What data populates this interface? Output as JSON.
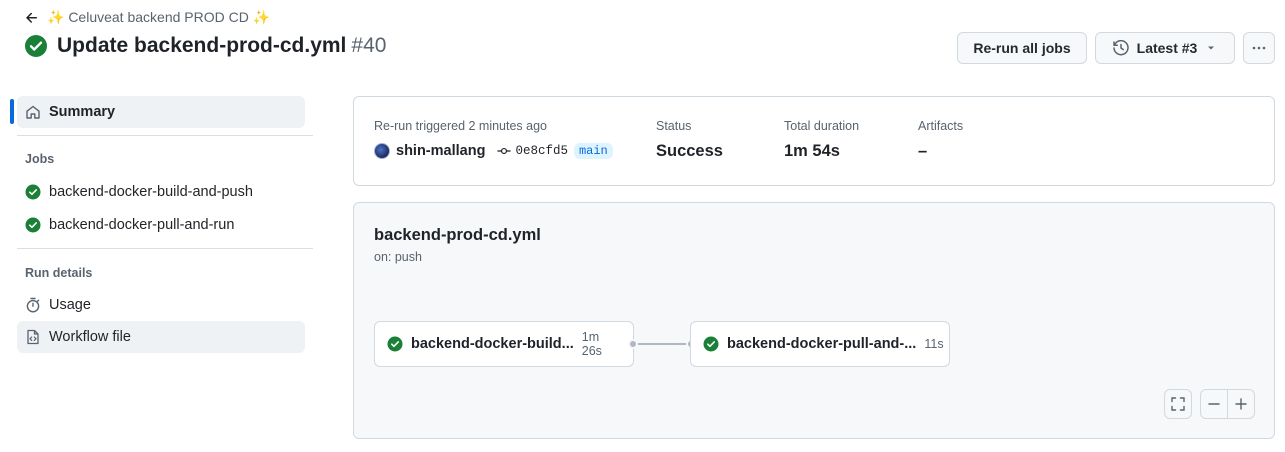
{
  "header": {
    "back_label": "✨ Celuveat backend PROD CD ✨",
    "title": "Update backend-prod-cd.yml",
    "run_number": "#40",
    "rerun_label": "Re-run all jobs",
    "latest_label": "Latest #3"
  },
  "sidebar": {
    "summary_label": "Summary",
    "jobs_heading": "Jobs",
    "jobs": [
      {
        "label": "backend-docker-build-and-push"
      },
      {
        "label": "backend-docker-pull-and-run"
      }
    ],
    "run_details_heading": "Run details",
    "usage_label": "Usage",
    "workflow_file_label": "Workflow file"
  },
  "summary": {
    "trigger_label": "Re-run triggered 2 minutes ago",
    "actor": "shin-mallang",
    "commit": "0e8cfd5",
    "branch": "main",
    "status_label": "Status",
    "status_value": "Success",
    "duration_label": "Total duration",
    "duration_value": "1m 54s",
    "artifacts_label": "Artifacts",
    "artifacts_value": "–"
  },
  "graph": {
    "workflow_name": "backend-prod-cd.yml",
    "trigger": "on: push",
    "jobs": [
      {
        "name": "backend-docker-build...",
        "duration": "1m 26s"
      },
      {
        "name": "backend-docker-pull-and-...",
        "duration": "11s"
      }
    ]
  },
  "colors": {
    "success": "#1a7f37",
    "accent": "#0969da"
  }
}
